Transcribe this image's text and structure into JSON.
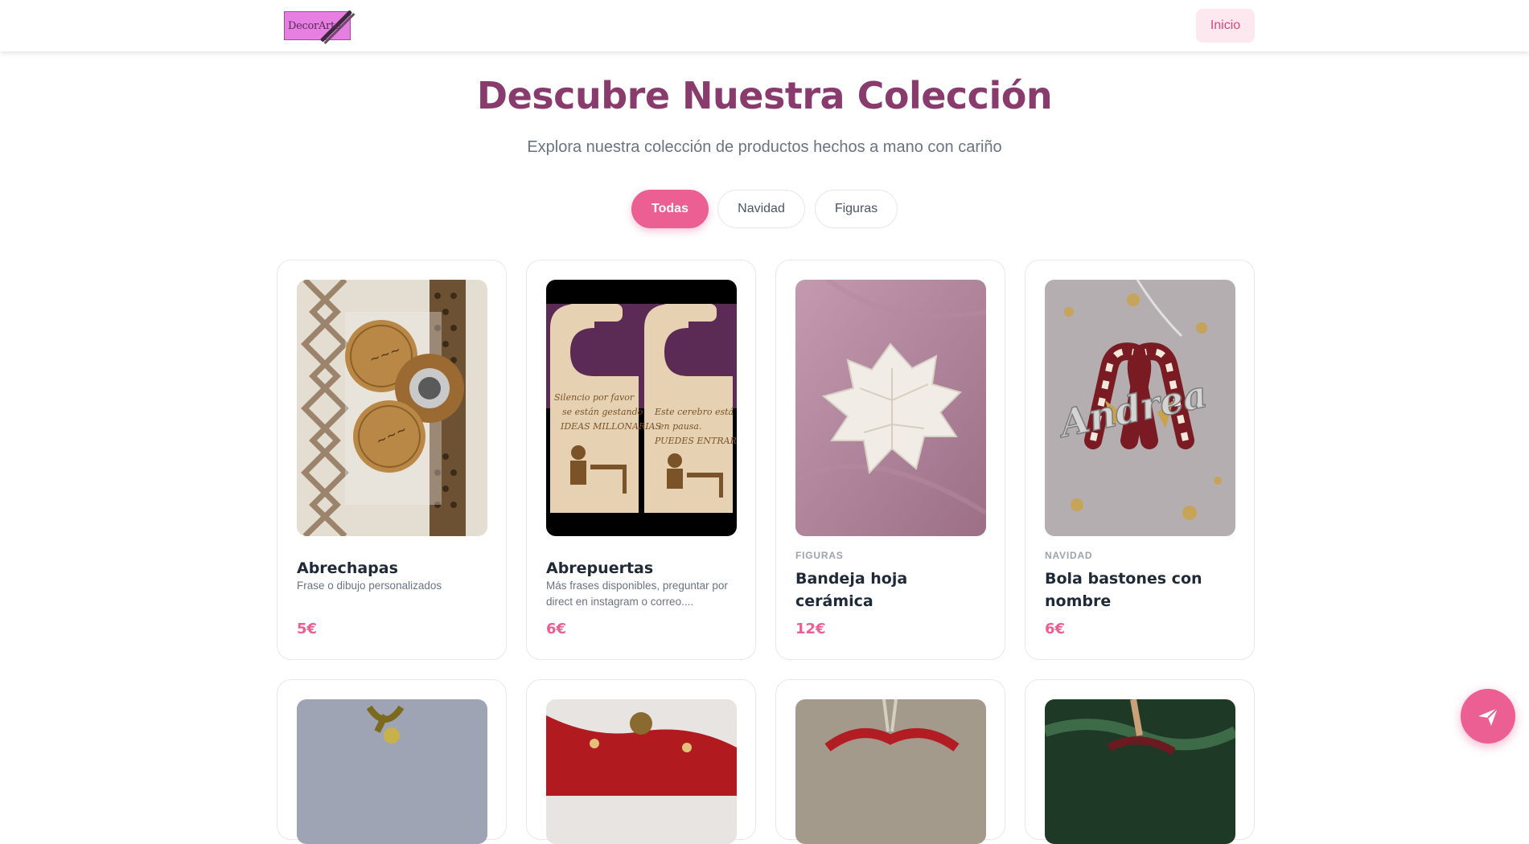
{
  "header": {
    "logo_text": "DecorArte",
    "nav_inicio": "Inicio"
  },
  "hero": {
    "title": "Descubre Nuestra Colección",
    "subtitle": "Explora nuestra colección de productos hechos a mano con cariño"
  },
  "filters": [
    "Todas",
    "Navidad",
    "Figuras"
  ],
  "active_filter": "Todas",
  "products": [
    {
      "name": "Abrechapas",
      "category": "",
      "description": "Frase o dibujo personalizados",
      "price": "5€"
    },
    {
      "name": "Abrepuertas",
      "category": "",
      "description": "Más frases disponibles, preguntar por direct en instagram o correo....",
      "price": "6€"
    },
    {
      "name": "Bandeja hoja cerámica",
      "category": "FIGURAS",
      "description": "",
      "price": "12€"
    },
    {
      "name": "Bola bastones con nombre",
      "category": "NAVIDAD",
      "description": "",
      "price": "6€"
    }
  ],
  "colors": {
    "accent": "#ec5f92",
    "title": "#8a3b6e",
    "nav_bg": "#fde8f0"
  },
  "icons": {
    "fab": "send-icon"
  }
}
